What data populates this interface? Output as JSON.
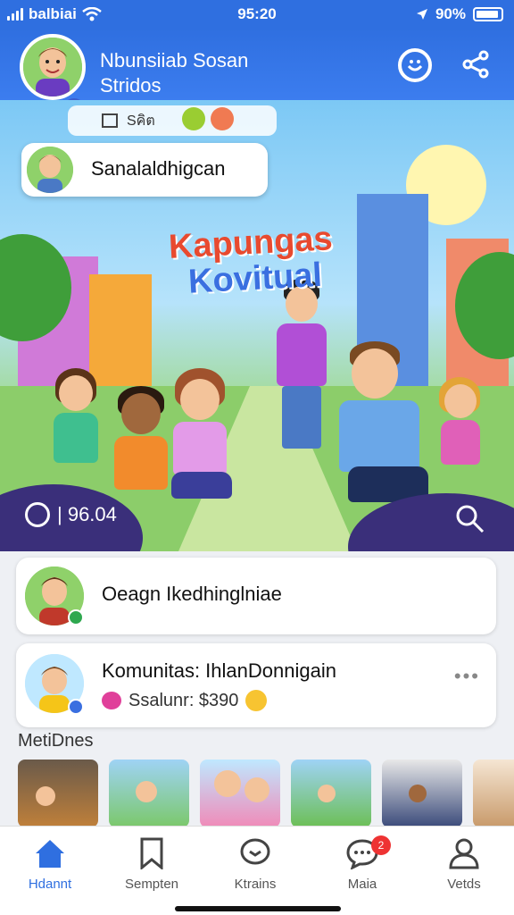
{
  "status_bar": {
    "carrier": "balbiai",
    "time": "95:20",
    "battery": "90%"
  },
  "header": {
    "title_line1": "Nbunsiiab Sosan",
    "title_line2": "Stridos"
  },
  "hero": {
    "mini_label": "Sคิต",
    "chip_text": "Sanalaldhigcan",
    "title_line1": "Kapungas",
    "title_line2": "Kovitual",
    "counter": "| 96.04"
  },
  "cards": [
    {
      "title": "Oeagn Ikedhinglniae"
    },
    {
      "title": "Komunitas: IhlanDonnigain",
      "subtitle": "Ssalunr: $390",
      "more": "•••"
    }
  ],
  "section": {
    "title": "MetiDnes"
  },
  "tabs": [
    {
      "label": "Hdannt",
      "icon": "home-icon"
    },
    {
      "label": "Sempten",
      "icon": "bookmark-icon"
    },
    {
      "label": "Ktrains",
      "icon": "chat-bubble-icon"
    },
    {
      "label": "Maia",
      "icon": "messages-icon",
      "badge": "2"
    },
    {
      "label": "Vetds",
      "icon": "person-icon"
    }
  ],
  "colors": {
    "primary": "#2f6fe0",
    "badge": "#e33333",
    "background": "#eef0f4"
  }
}
